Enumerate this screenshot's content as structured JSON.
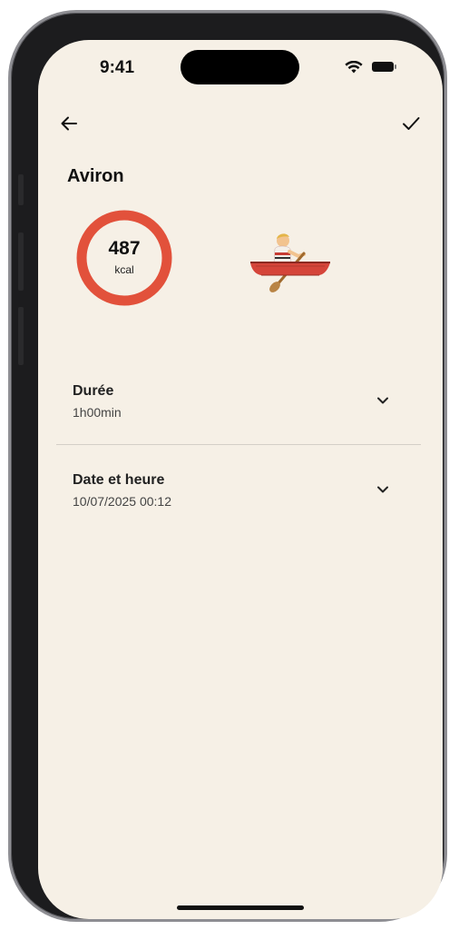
{
  "status_bar": {
    "time": "9:41"
  },
  "header": {
    "back_icon": "arrow-left-icon",
    "confirm_icon": "check-icon"
  },
  "activity": {
    "title": "Aviron",
    "calories_value": "487",
    "calories_unit": "kcal",
    "ring_color": "#e2513b",
    "illustration": "rowboat-emoji"
  },
  "fields": [
    {
      "label": "Durée",
      "value": "1h00min"
    },
    {
      "label": "Date et heure",
      "value": "10/07/2025 00:12"
    }
  ],
  "colors": {
    "background": "#f6f0e6",
    "accent": "#e2513b"
  }
}
